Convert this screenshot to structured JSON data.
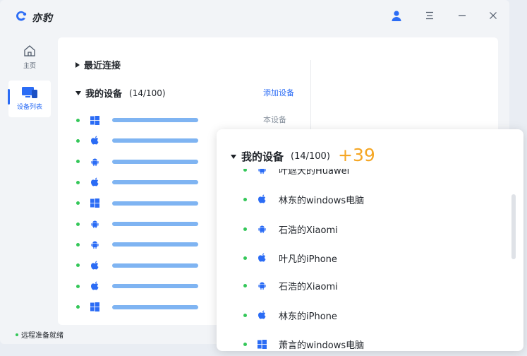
{
  "app": {
    "title": "亦豹"
  },
  "sidebar": {
    "items": [
      {
        "label": "主页",
        "icon": "home-icon"
      },
      {
        "label": "设备列表",
        "icon": "devices-icon"
      }
    ]
  },
  "sections": {
    "recent": {
      "title": "最近连接"
    },
    "my_devices": {
      "title": "我的设备",
      "count": "(14/100)",
      "add_label": "添加设备",
      "this_device_label": "本设备"
    }
  },
  "device_rows": [
    "windows",
    "apple",
    "android",
    "apple",
    "windows",
    "android",
    "android",
    "apple",
    "apple",
    "windows"
  ],
  "status": {
    "text": "远程准备就绪",
    "color": "#34c759"
  },
  "popup": {
    "title": "我的设备",
    "count": "(14/100)",
    "badge": "+39",
    "items": [
      {
        "icon": "android",
        "name": "叶遮天的Huawei"
      },
      {
        "icon": "apple",
        "name": "林东的windows电脑"
      },
      {
        "icon": "android",
        "name": "石浩的Xiaomi"
      },
      {
        "icon": "apple",
        "name": "叶凡的iPhone"
      },
      {
        "icon": "android",
        "name": "石浩的Xiaomi"
      },
      {
        "icon": "apple",
        "name": "林东的iPhone"
      },
      {
        "icon": "windows",
        "name": "萧言的windows电脑"
      }
    ]
  },
  "colors": {
    "accent": "#2b6cf5",
    "online": "#34c759",
    "badge": "#f5a623"
  }
}
